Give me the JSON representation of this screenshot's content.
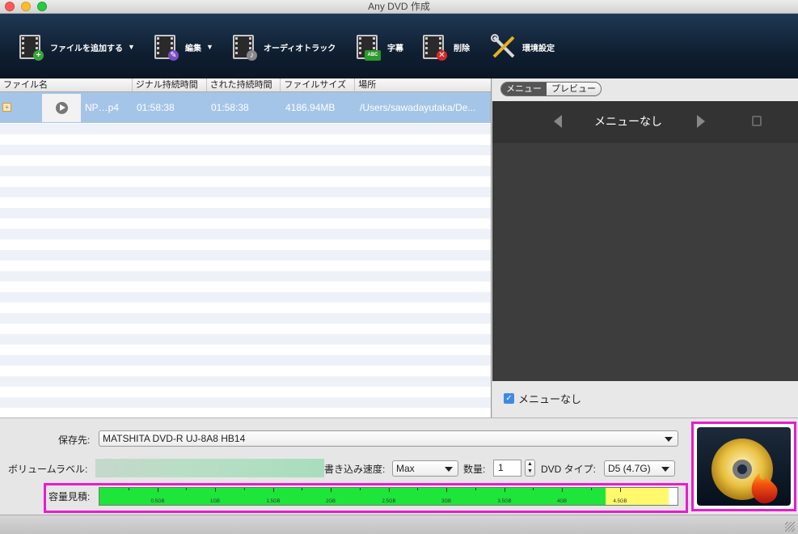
{
  "window": {
    "title": "Any DVD 作成"
  },
  "toolbar": {
    "add_file": "ファイルを追加する",
    "edit": "編集",
    "audio_track": "オーディオトラック",
    "subtitle": "字幕",
    "delete": "削除",
    "settings": "環境設定"
  },
  "file_list": {
    "columns": [
      "ファイル名",
      "ジナル持続時間",
      "された持続時間",
      "ファイルサイズ",
      "場所"
    ],
    "rows": [
      {
        "name": "NP…p4",
        "original_duration": "01:58:38",
        "trimmed_duration": "01:58:38",
        "size": "4186.94MB",
        "location": "/Users/sawadayutaka/De..."
      }
    ]
  },
  "menu_panel": {
    "tab_menu": "メニュー",
    "tab_preview": "プレビュー",
    "menu_title": "メニューなし",
    "no_menu_checkbox_label": "メニューなし",
    "no_menu_checked": true
  },
  "output": {
    "save_to_label": "保存先:",
    "save_to_value": "MATSHITA DVD-R   UJ-8A8 HB14",
    "volume_label_label": "ボリュームラベル:",
    "volume_label_value": "",
    "write_speed_label": "書き込み速度:",
    "write_speed_value": "Max",
    "quantity_label": "数量:",
    "quantity_value": "1",
    "dvd_type_label": "DVD タイプ:",
    "dvd_type_value": "D5 (4.7G)",
    "capacity_label": "容量見積:",
    "capacity_ticks": [
      "0.5GB",
      "1GB",
      "1.5GB",
      "2GB",
      "2.5GB",
      "3GB",
      "3.5GB",
      "4GB",
      "4.5GB"
    ],
    "capacity_used_fraction": 0.985,
    "capacity_green_fraction": 0.876
  },
  "colors": {
    "toolbar_bg": "#0f1f31",
    "selection": "#a5c5e8",
    "capacity_green": "#1ee53a",
    "capacity_yellow": "#fff96b",
    "highlight_frame": "#e81ccf"
  },
  "icons": {
    "add_file": "film-plus-icon",
    "edit": "film-edit-icon",
    "audio_track": "film-audio-icon",
    "subtitle": "film-abc-icon",
    "delete": "film-delete-icon",
    "settings": "tools-icon",
    "burn": "disc-burn-icon"
  }
}
